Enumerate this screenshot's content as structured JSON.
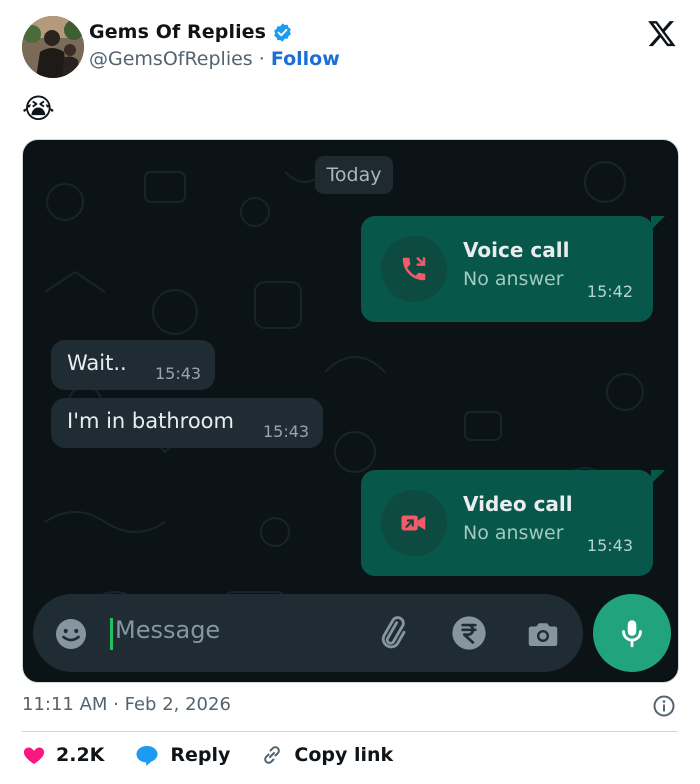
{
  "tweet": {
    "display_name": "Gems Of Replies",
    "handle": "@GemsOfReplies",
    "separator": "·",
    "follow_label": "Follow",
    "text_emoji": "😭",
    "timestamp": "11:11 AM · Feb 2, 2026",
    "actions": {
      "likes": "2.2K",
      "reply": "Reply",
      "copy_link": "Copy link"
    },
    "colors": {
      "verified": "#1d9bf0",
      "follow": "#1d6fd6",
      "like": "#f91880",
      "reply_icon": "#1d9bf0"
    }
  },
  "chat_screenshot": {
    "date_chip": "Today",
    "messages": [
      {
        "direction": "outgoing",
        "type": "call",
        "title": "Voice call",
        "subtitle": "No answer",
        "time": "15:42",
        "icon": "missed-voice-call-icon"
      },
      {
        "direction": "incoming",
        "text": "Wait..",
        "time": "15:43"
      },
      {
        "direction": "incoming",
        "text": "I'm in bathroom",
        "time": "15:43"
      },
      {
        "direction": "outgoing",
        "type": "call",
        "title": "Video call",
        "subtitle": "No answer",
        "time": "15:43",
        "icon": "missed-video-call-icon"
      }
    ],
    "composer": {
      "placeholder": "Message"
    },
    "colors": {
      "background": "#0c1317",
      "outgoing_bubble": "#07574a",
      "incoming_bubble": "#202c33",
      "missed_call": "#f15c6d",
      "mic_button": "#21a47d"
    }
  }
}
